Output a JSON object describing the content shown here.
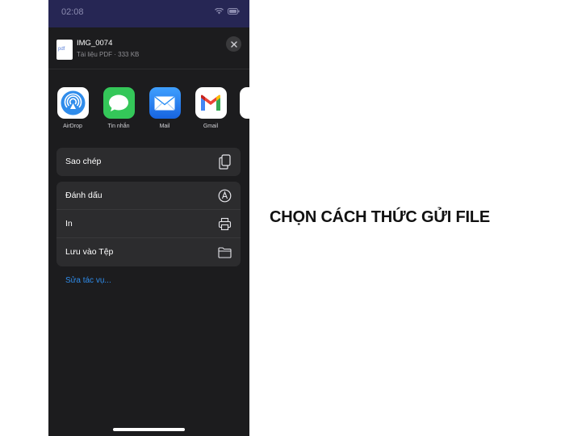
{
  "status_bar": {
    "time": "02:08"
  },
  "share_sheet": {
    "file": {
      "thumb_label": "pdf",
      "name": "IMG_0074",
      "meta": "Tài liệu PDF · 333 KB"
    },
    "apps": [
      {
        "label": "AirDrop",
        "icon": "airdrop-icon",
        "color": "#2f8ceb"
      },
      {
        "label": "Tin nhắn",
        "icon": "messages-icon",
        "color": "#34c759"
      },
      {
        "label": "Mail",
        "icon": "mail-icon",
        "color": "#1e88f5"
      },
      {
        "label": "Gmail",
        "icon": "gmail-icon",
        "color": "#ea4335"
      }
    ],
    "actions_group_1": [
      {
        "label": "Sao chép",
        "icon": "copy-icon"
      }
    ],
    "actions_group_2": [
      {
        "label": "Đánh dấu",
        "icon": "markup-icon"
      },
      {
        "label": "In",
        "icon": "print-icon"
      },
      {
        "label": "Lưu vào Tệp",
        "icon": "folder-icon"
      }
    ],
    "edit_actions_label": "Sửa tác vụ..."
  },
  "caption": "CHỌN CÁCH THỨC GỬI FILE",
  "colors": {
    "sheet_background": "#1c1c1e",
    "row_background": "#2c2c2e",
    "link": "#2f8ceb",
    "status_bar": "#262654"
  }
}
